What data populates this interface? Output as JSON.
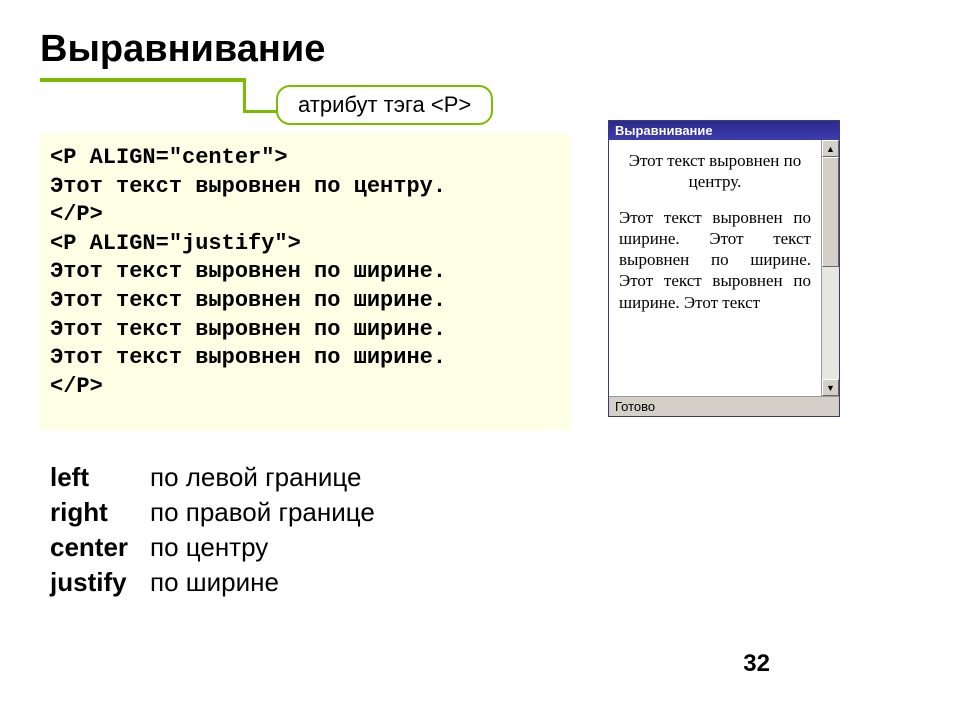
{
  "title": "Выравнивание",
  "callout": "атрибут тэга <P>",
  "code": {
    "l1": "<P ALIGN=\"center\">",
    "l2": "Этот текст выровнен по центру.",
    "l3": "</P>",
    "l4": "<P ALIGN=\"justify\">",
    "l5": "Этот текст выровнен по ширине.",
    "l6": "Этот текст выровнен по ширине.",
    "l7": "Этот текст выровнен по ширине.",
    "l8": "Этот текст выровнен по ширине.",
    "l9": "</P>"
  },
  "browser": {
    "title": "Выравнивание",
    "center": "Этот текст выровнен по центру.",
    "justify": "Этот текст выровнен по ширине. Этот текст выровнен по ширине. Этот текст выровнен по ширине. Этот текст",
    "status": "Готово",
    "up": "▲",
    "down": "▼"
  },
  "defs": {
    "k1": "left",
    "v1": "по левой границе",
    "k2": "right",
    "v2": "по правой границе",
    "k3": "center",
    "v3": "по центру",
    "k4": "justify",
    "v4": "по ширине"
  },
  "page": "32"
}
